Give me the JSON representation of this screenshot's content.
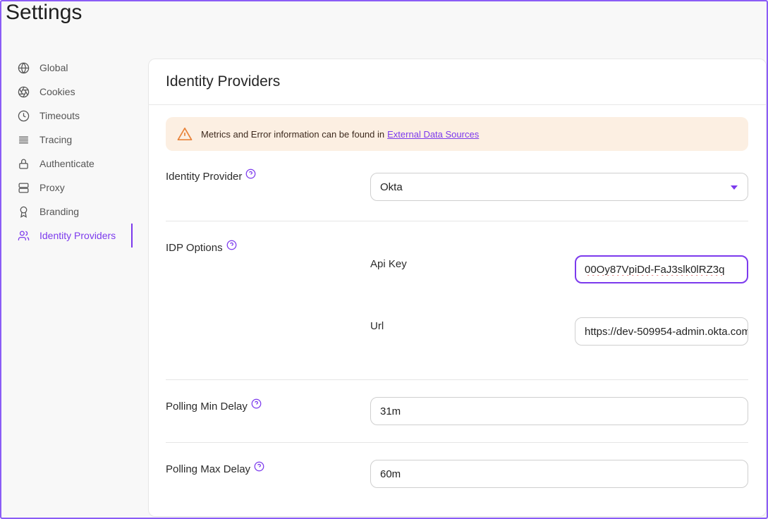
{
  "page": {
    "title": "Settings"
  },
  "sidebar": {
    "items": [
      {
        "label": "Global",
        "icon": "globe-icon"
      },
      {
        "label": "Cookies",
        "icon": "aperture-icon"
      },
      {
        "label": "Timeouts",
        "icon": "clock-icon"
      },
      {
        "label": "Tracing",
        "icon": "list-icon"
      },
      {
        "label": "Authenticate",
        "icon": "lock-icon"
      },
      {
        "label": "Proxy",
        "icon": "server-icon"
      },
      {
        "label": "Branding",
        "icon": "award-icon"
      },
      {
        "label": "Identity Providers",
        "icon": "users-icon",
        "active": true
      }
    ]
  },
  "main": {
    "title": "Identity Providers",
    "alert": {
      "text": "Metrics and Error information can be found in",
      "link": "External Data Sources",
      "icon": "warning-icon"
    },
    "identity_provider": {
      "label": "Identity Provider",
      "value": "Okta"
    },
    "idp_options": {
      "label": "IDP Options",
      "api_key": {
        "label": "Api Key",
        "value": "00Oy87VpiDd-FaJ3slk0lRZ3q"
      },
      "url": {
        "label": "Url",
        "value": "https://dev-509954-admin.okta.com"
      }
    },
    "polling_min": {
      "label": "Polling Min Delay",
      "value": "31m"
    },
    "polling_max": {
      "label": "Polling Max Delay",
      "value": "60m"
    }
  },
  "colors": {
    "accent": "#7c3aed",
    "alert_bg": "#fcefe2",
    "warning": "#e8833a"
  }
}
